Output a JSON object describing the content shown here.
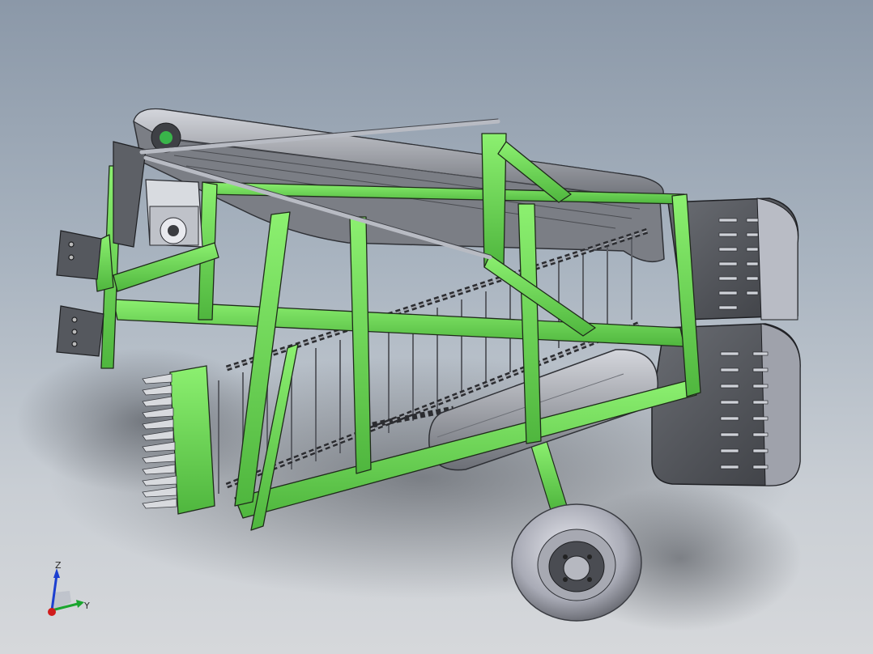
{
  "triad": {
    "z_label": "Z",
    "y_label": "Y"
  },
  "colors": {
    "frame_green": "#6fe25a",
    "frame_green_dark": "#3f9a34",
    "steel_dark": "#55585d",
    "steel_mid": "#7d8087",
    "steel_light": "#c9ccd3",
    "background_top": "#8b98a8",
    "background_bottom": "#d6d8db"
  }
}
